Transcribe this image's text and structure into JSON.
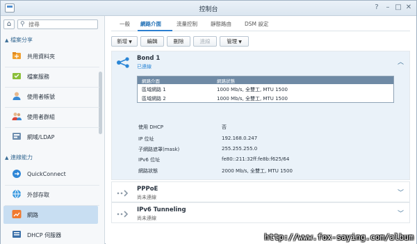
{
  "window": {
    "title": "控制台",
    "controls": {
      "help": "?",
      "minimize": "–",
      "maximize": "□",
      "close": "✕"
    }
  },
  "sidebar": {
    "home_icon": "home-icon",
    "search": {
      "placeholder": "搜尋"
    },
    "sections": [
      {
        "label": "檔案分享",
        "items": [
          {
            "label": "共用資料夾",
            "icon": "shared-folder-icon"
          },
          {
            "label": "檔案服務",
            "icon": "file-services-icon"
          },
          {
            "label": "使用者帳號",
            "icon": "user-icon"
          },
          {
            "label": "使用者群組",
            "icon": "group-icon"
          },
          {
            "label": "網域/LDAP",
            "icon": "domain-icon"
          }
        ]
      },
      {
        "label": "連線能力",
        "items": [
          {
            "label": "QuickConnect",
            "icon": "quickconnect-icon"
          },
          {
            "label": "外部存取",
            "icon": "external-access-icon"
          },
          {
            "label": "網路",
            "icon": "network-icon",
            "active": true
          },
          {
            "label": "DHCP 伺服器",
            "icon": "dhcp-icon"
          }
        ]
      }
    ]
  },
  "tabs": [
    {
      "label": "一般"
    },
    {
      "label": "網路介面",
      "active": true
    },
    {
      "label": "流量控制"
    },
    {
      "label": "靜態路由"
    },
    {
      "label": "DSM 設定"
    }
  ],
  "toolbar": {
    "create": "新增",
    "edit": "編輯",
    "delete": "刪除",
    "connect": "連線",
    "manage": "管理"
  },
  "interfaces": [
    {
      "name": "Bond 1",
      "status": "已連線",
      "status_color": "#2b86d6",
      "table_headers": {
        "interface": "網路介面",
        "status": "網路狀態"
      },
      "table_rows": [
        {
          "interface": "區域網路 1",
          "status": "1000 Mb/s, 全雙工, MTU 1500"
        },
        {
          "interface": "區域網路 2",
          "status": "1000 Mb/s, 全雙工, MTU 1500"
        }
      ],
      "details": [
        {
          "key": "使用 DHCP",
          "value": "否"
        },
        {
          "key": "IP 位址",
          "value": "192.168.0.247"
        },
        {
          "key": "子網路遮罩(mask)",
          "value": "255.255.255.0"
        },
        {
          "key": "IPv6 位址",
          "value": "fe80::211:32ff:fe8b:f625/64"
        },
        {
          "key": "網路狀態",
          "value": "2000 Mb/s, 全雙工, MTU 1500"
        }
      ]
    },
    {
      "name": "PPPoE",
      "status": "尚未連線",
      "status_color": "#666666"
    },
    {
      "name": "IPv6 Tunneling",
      "status": "尚未連線",
      "status_color": "#666666"
    }
  ],
  "watermark": "http://www.fox-saying.com/album"
}
